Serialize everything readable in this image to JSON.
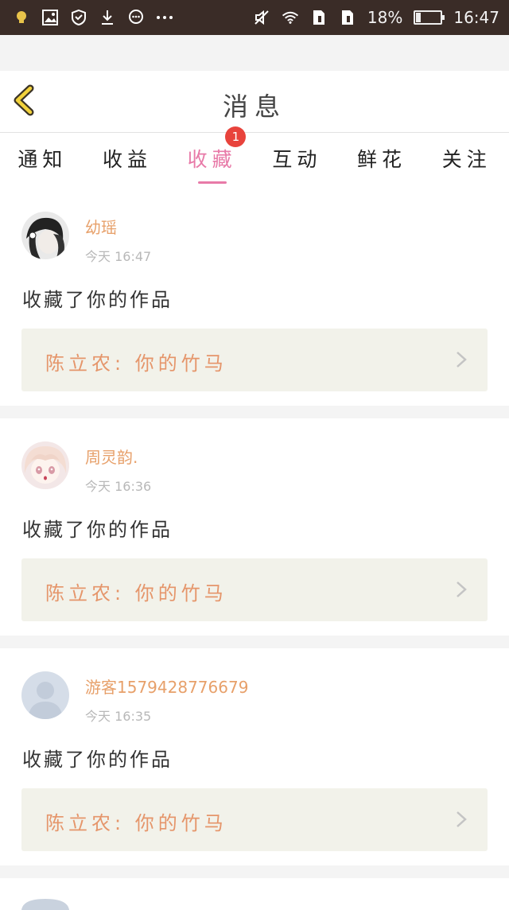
{
  "status_bar": {
    "battery_percent": "18%",
    "battery_level": 0.18,
    "time": "16:47",
    "left_icons": [
      "bulb-icon",
      "image-icon",
      "shield-icon",
      "download-icon",
      "chat-icon",
      "more-dots-icon"
    ],
    "right_icons": [
      "mute-icon",
      "wifi-icon",
      "sim1-icon",
      "sim2-icon",
      "battery-icon"
    ]
  },
  "header": {
    "title": "消息"
  },
  "tabs": [
    {
      "label": "通知",
      "active": false
    },
    {
      "label": "收益",
      "active": false
    },
    {
      "label": "收藏",
      "active": true,
      "badge": "1"
    },
    {
      "label": "互动",
      "active": false
    },
    {
      "label": "鲜花",
      "active": false
    },
    {
      "label": "关注",
      "active": false
    }
  ],
  "colors": {
    "accent": "#e87aa8",
    "badge": "#e8433c",
    "name": "#e7a06a",
    "work_text": "#e5956a",
    "status_bar": "#3a2c27"
  },
  "items": [
    {
      "name": "幼瑶",
      "time": "今天 16:47",
      "desc": "收藏了你的作品",
      "work": "陈立农: 你的竹马",
      "avatar": "girl-avatar"
    },
    {
      "name": "周灵韵.",
      "time": "今天 16:36",
      "desc": "收藏了你的作品",
      "work": "陈立农: 你的竹马",
      "avatar": "anime-avatar"
    },
    {
      "name": "游客1579428776679",
      "time": "今天 16:35",
      "desc": "收藏了你的作品",
      "work": "陈立农: 你的竹马",
      "avatar": "default-avatar"
    }
  ]
}
